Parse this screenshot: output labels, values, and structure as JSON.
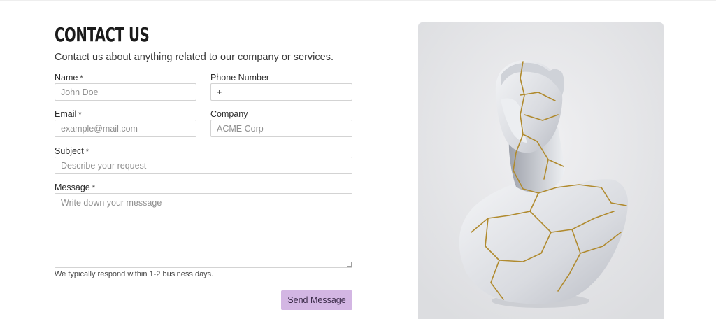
{
  "page": {
    "title": "CONTACT US",
    "subtitle": "Contact us about anything related to our company or services."
  },
  "form": {
    "name": {
      "label": "Name",
      "required_mark": "*",
      "placeholder": "John Doe",
      "value": ""
    },
    "phone": {
      "label": "Phone Number",
      "value": "+"
    },
    "email": {
      "label": "Email",
      "required_mark": "*",
      "placeholder": "example@mail.com",
      "value": ""
    },
    "company": {
      "label": "Company",
      "placeholder": "ACME Corp",
      "value": ""
    },
    "subject": {
      "label": "Subject",
      "required_mark": "*",
      "placeholder": "Describe your request",
      "value": ""
    },
    "message": {
      "label": "Message",
      "required_mark": "*",
      "placeholder": "Write down your message",
      "value": ""
    },
    "response_note": "We typically respond within 1-2 business days.",
    "submit_label": "Send Message"
  },
  "colors": {
    "button_bg": "#d3b6e3",
    "panel_bg": "#e6e6e8",
    "crack_gold": "#b08a2e"
  }
}
